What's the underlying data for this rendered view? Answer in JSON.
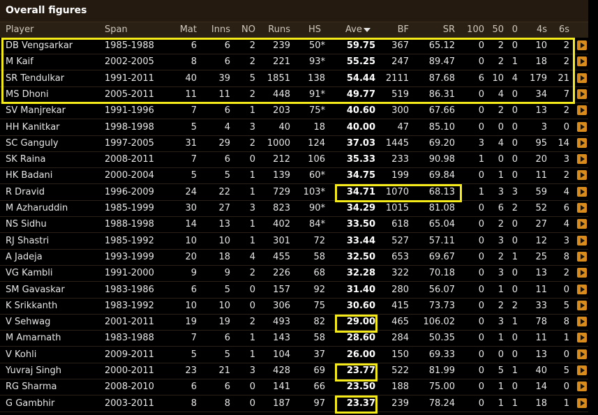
{
  "title": "Overall figures",
  "columns": {
    "player": "Player",
    "span": "Span",
    "mat": "Mat",
    "inns": "Inns",
    "no": "NO",
    "runs": "Runs",
    "hs": "HS",
    "ave": "Ave",
    "bf": "BF",
    "sr": "SR",
    "h100": "100",
    "h50": "50",
    "zero": "0",
    "fours": "4s",
    "sixes": "6s"
  },
  "sort_icon": "sort-descending-icon",
  "row_action_icon": "expand-arrow-icon",
  "highlight_color": "#f5ea1a",
  "rows": [
    [
      "DB Vengsarkar",
      "1985-1988",
      "6",
      "6",
      "2",
      "239",
      "50*",
      "59.75",
      "367",
      "65.12",
      "0",
      "2",
      "0",
      "10",
      "2"
    ],
    [
      "M Kaif",
      "2002-2005",
      "8",
      "6",
      "2",
      "221",
      "93*",
      "55.25",
      "247",
      "89.47",
      "0",
      "2",
      "1",
      "18",
      "2"
    ],
    [
      "SR Tendulkar",
      "1991-2011",
      "40",
      "39",
      "5",
      "1851",
      "138",
      "54.44",
      "2111",
      "87.68",
      "6",
      "10",
      "4",
      "179",
      "21"
    ],
    [
      "MS Dhoni",
      "2005-2011",
      "11",
      "11",
      "2",
      "448",
      "91*",
      "49.77",
      "519",
      "86.31",
      "0",
      "4",
      "0",
      "34",
      "7"
    ],
    [
      "SV Manjrekar",
      "1991-1996",
      "7",
      "6",
      "1",
      "203",
      "75*",
      "40.60",
      "300",
      "67.66",
      "0",
      "2",
      "0",
      "13",
      "2"
    ],
    [
      "HH Kanitkar",
      "1998-1998",
      "5",
      "4",
      "3",
      "40",
      "18",
      "40.00",
      "47",
      "85.10",
      "0",
      "0",
      "0",
      "3",
      "0"
    ],
    [
      "SC Ganguly",
      "1997-2005",
      "31",
      "29",
      "2",
      "1000",
      "124",
      "37.03",
      "1445",
      "69.20",
      "3",
      "4",
      "0",
      "95",
      "14"
    ],
    [
      "SK Raina",
      "2008-2011",
      "7",
      "6",
      "0",
      "212",
      "106",
      "35.33",
      "233",
      "90.98",
      "1",
      "0",
      "0",
      "20",
      "3"
    ],
    [
      "HK Badani",
      "2000-2004",
      "5",
      "5",
      "1",
      "139",
      "60*",
      "34.75",
      "199",
      "69.84",
      "0",
      "1",
      "0",
      "11",
      "2"
    ],
    [
      "R Dravid",
      "1996-2009",
      "24",
      "22",
      "1",
      "729",
      "103*",
      "34.71",
      "1070",
      "68.13",
      "1",
      "3",
      "3",
      "59",
      "4"
    ],
    [
      "M Azharuddin",
      "1985-1999",
      "30",
      "27",
      "3",
      "823",
      "90*",
      "34.29",
      "1015",
      "81.08",
      "0",
      "6",
      "2",
      "52",
      "6"
    ],
    [
      "NS Sidhu",
      "1988-1998",
      "14",
      "13",
      "1",
      "402",
      "84*",
      "33.50",
      "618",
      "65.04",
      "0",
      "2",
      "0",
      "27",
      "4"
    ],
    [
      "RJ Shastri",
      "1985-1992",
      "10",
      "10",
      "1",
      "301",
      "72",
      "33.44",
      "527",
      "57.11",
      "0",
      "3",
      "0",
      "12",
      "3"
    ],
    [
      "A Jadeja",
      "1993-1999",
      "20",
      "18",
      "4",
      "455",
      "58",
      "32.50",
      "653",
      "69.67",
      "0",
      "2",
      "1",
      "25",
      "8"
    ],
    [
      "VG Kambli",
      "1991-2000",
      "9",
      "9",
      "2",
      "226",
      "68",
      "32.28",
      "322",
      "70.18",
      "0",
      "3",
      "0",
      "13",
      "2"
    ],
    [
      "SM Gavaskar",
      "1983-1986",
      "6",
      "5",
      "0",
      "157",
      "92",
      "31.40",
      "280",
      "56.07",
      "0",
      "1",
      "0",
      "11",
      "0"
    ],
    [
      "K Srikkanth",
      "1983-1992",
      "10",
      "10",
      "0",
      "306",
      "75",
      "30.60",
      "415",
      "73.73",
      "0",
      "2",
      "2",
      "33",
      "5"
    ],
    [
      "V Sehwag",
      "2001-2011",
      "19",
      "19",
      "2",
      "493",
      "82",
      "29.00",
      "465",
      "106.02",
      "0",
      "3",
      "1",
      "78",
      "8"
    ],
    [
      "M Amarnath",
      "1983-1988",
      "7",
      "6",
      "1",
      "143",
      "58",
      "28.60",
      "284",
      "50.35",
      "0",
      "1",
      "0",
      "11",
      "1"
    ],
    [
      "V Kohli",
      "2009-2011",
      "5",
      "5",
      "1",
      "104",
      "37",
      "26.00",
      "150",
      "69.33",
      "0",
      "0",
      "0",
      "13",
      "0"
    ],
    [
      "Yuvraj Singh",
      "2000-2011",
      "23",
      "21",
      "3",
      "428",
      "69",
      "23.77",
      "522",
      "81.99",
      "0",
      "5",
      "1",
      "40",
      "5"
    ],
    [
      "RG Sharma",
      "2008-2010",
      "6",
      "6",
      "0",
      "141",
      "66",
      "23.50",
      "188",
      "75.00",
      "0",
      "1",
      "0",
      "14",
      "0"
    ],
    [
      "G Gambhir",
      "2003-2011",
      "8",
      "8",
      "0",
      "187",
      "97",
      "23.37",
      "239",
      "78.24",
      "0",
      "1",
      "1",
      "18",
      "1"
    ]
  ]
}
